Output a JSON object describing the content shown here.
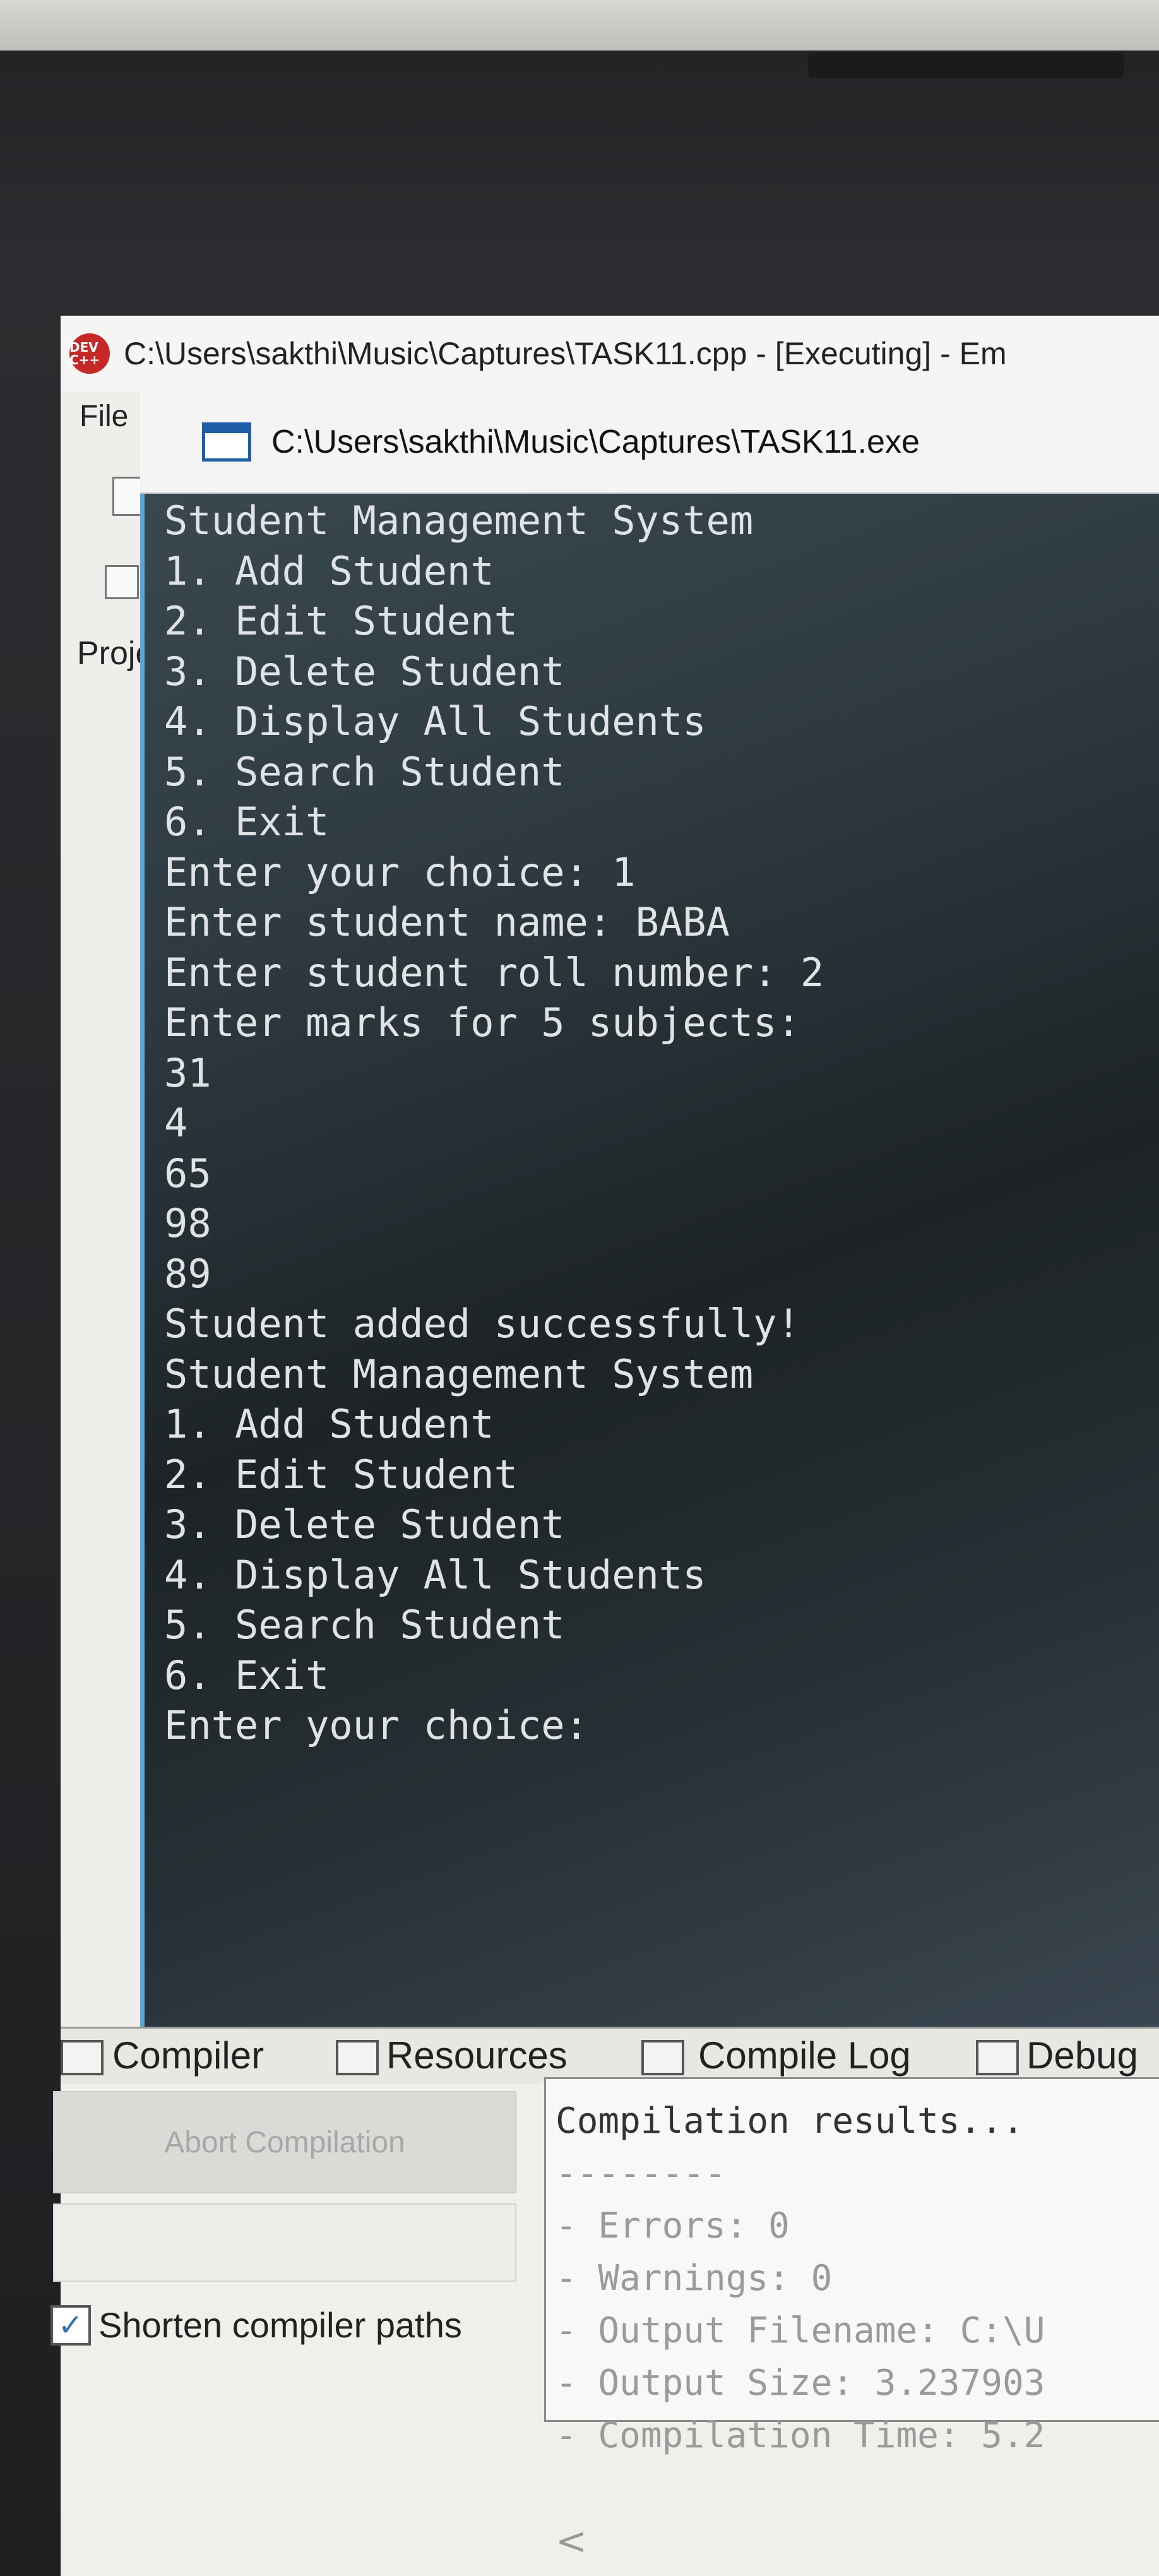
{
  "ide": {
    "title": "C:\\Users\\sakthi\\Music\\Captures\\TASK11.cpp - [Executing] - Em",
    "logo_text": "DEV C++",
    "menu_file": "File",
    "project_tab": "Proje"
  },
  "console": {
    "title": "C:\\Users\\sakthi\\Music\\Captures\\TASK11.exe",
    "lines": [
      "Student Management System",
      "1. Add Student",
      "2. Edit Student",
      "3. Delete Student",
      "4. Display All Students",
      "5. Search Student",
      "6. Exit",
      "Enter your choice: 1",
      "Enter student name: BABA",
      "Enter student roll number: 2",
      "Enter marks for 5 subjects:",
      "31",
      "4",
      "65",
      "98",
      "89",
      "Student added successfully!",
      "Student Management System",
      "1. Add Student",
      "2. Edit Student",
      "3. Delete Student",
      "4. Display All Students",
      "5. Search Student",
      "6. Exit",
      "Enter your choice:"
    ]
  },
  "bottom_tabs": {
    "compiler": "Compiler",
    "resources": "Resources",
    "compile_log": "Compile Log",
    "debug": "Debug"
  },
  "bottom_panel": {
    "abort_button": "Abort Compilation",
    "shorten_paths_label": "Shorten compiler paths",
    "shorten_paths_checked": true,
    "results_lines": [
      "Compilation results...",
      "--------",
      "- Errors: 0",
      "- Warnings: 0",
      "- Output Filename: C:\\U",
      "- Output Size: 3.237903",
      "- Compilation Time: 5.2"
    ]
  },
  "colors": {
    "console_border": "#5aa6d8",
    "console_text": "#dfe3e6",
    "logo_red": "#c62828"
  }
}
